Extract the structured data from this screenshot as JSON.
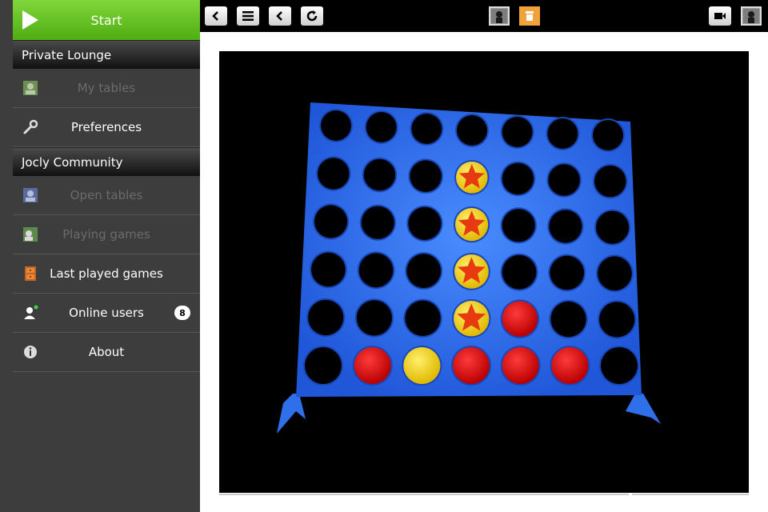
{
  "sidebar": {
    "start_label": "Start",
    "sections": [
      {
        "title": "Private Lounge"
      },
      {
        "title": "Jocly Community"
      }
    ],
    "items": [
      {
        "label": "My tables",
        "icon": "my-tables-icon",
        "enabled": false
      },
      {
        "label": "Preferences",
        "icon": "wrench-icon",
        "enabled": true
      },
      {
        "label": "Open tables",
        "icon": "open-tables-icon",
        "enabled": false
      },
      {
        "label": "Playing games",
        "icon": "playing-games-icon",
        "enabled": false
      },
      {
        "label": "Last played games",
        "icon": "cabinet-icon",
        "enabled": true
      },
      {
        "label": "Online users",
        "icon": "user-online-icon",
        "enabled": true,
        "badge": "8"
      },
      {
        "label": "About",
        "icon": "info-icon",
        "enabled": true
      }
    ]
  },
  "toolbar": {
    "left_buttons": [
      "back-icon",
      "menu-icon",
      "previous-icon",
      "refresh-icon"
    ],
    "center_avatars": [
      "player-avatar-icon",
      "active-player-icon"
    ],
    "right": [
      "video-camera-icon",
      "user-avatar-icon"
    ]
  },
  "game": {
    "name": "Connect Four",
    "columns": 7,
    "rows": 6,
    "colors": {
      "board": "#2f6fea",
      "red": "#d40000",
      "yellow": "#f5d400",
      "star": "#e83a10"
    },
    "grid": [
      [
        "",
        "",
        "",
        "",
        "",
        "",
        ""
      ],
      [
        "",
        "",
        "",
        "Y*",
        "",
        "",
        ""
      ],
      [
        "",
        "",
        "",
        "Y*",
        "",
        "",
        ""
      ],
      [
        "",
        "",
        "",
        "Y*",
        "",
        "",
        ""
      ],
      [
        "",
        "",
        "",
        "Y*",
        "R",
        "",
        ""
      ],
      [
        "",
        "R",
        "Y",
        "R",
        "R",
        "R",
        ""
      ]
    ]
  }
}
